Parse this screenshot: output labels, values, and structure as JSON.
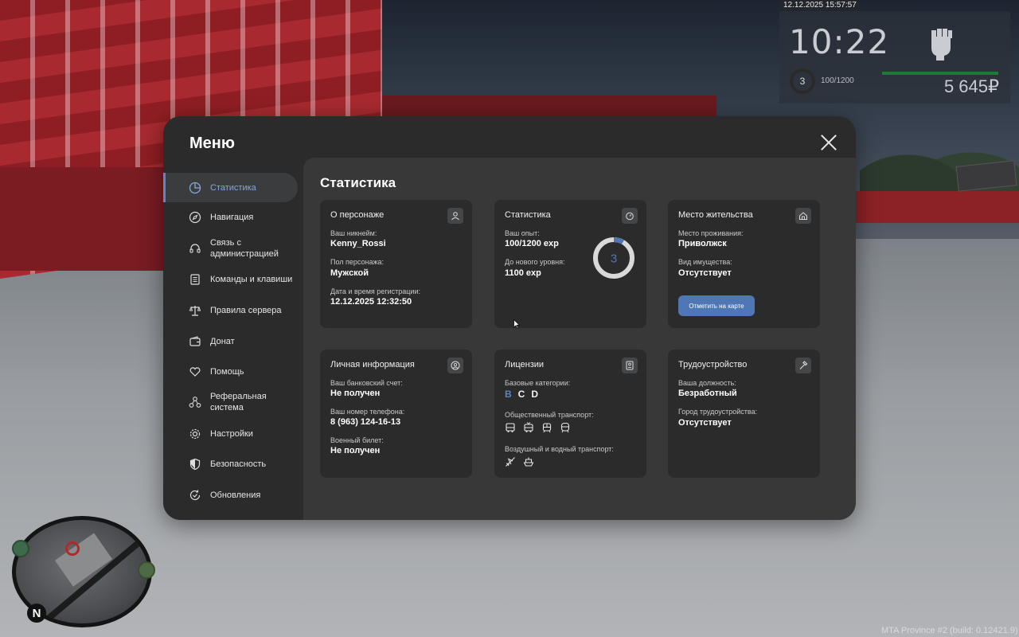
{
  "hud": {
    "timestamp": "12.12.2025 15:57:57",
    "clock": "10:22",
    "level": "3",
    "xp": "100/1200",
    "money": "5 645₽",
    "build": "MTA Province #2 (build: 0.12421.9)",
    "minimap_north": "N"
  },
  "menu": {
    "title": "Меню",
    "sidebar": [
      {
        "label": "Статистика",
        "icon": "pie-chart-icon",
        "active": true
      },
      {
        "label": "Навигация",
        "icon": "compass-icon"
      },
      {
        "label": "Связь с администрацией",
        "icon": "headset-icon"
      },
      {
        "label": "Команды и клавиши",
        "icon": "document-list-icon"
      },
      {
        "label": "Правила сервера",
        "icon": "scales-icon"
      },
      {
        "label": "Донат",
        "icon": "wallet-icon"
      },
      {
        "label": "Помощь",
        "icon": "handshake-heart-icon"
      },
      {
        "label": "Реферальная система",
        "icon": "people-network-icon"
      },
      {
        "label": "Настройки",
        "icon": "gear-icon"
      },
      {
        "label": "Безопасность",
        "icon": "shield-icon"
      },
      {
        "label": "Обновления",
        "icon": "refresh-check-icon"
      }
    ]
  },
  "content": {
    "title": "Статистика",
    "character": {
      "title": "О персонаже",
      "nickname_label": "Ваш никнейм:",
      "nickname": "Kenny_Rossi",
      "gender_label": "Пол персонажа:",
      "gender": "Мужской",
      "reg_label": "Дата и время регистрации:",
      "reg_date": "12.12.2025 12:32:50"
    },
    "stats": {
      "title": "Статистика",
      "xp_label": "Ваш опыт:",
      "xp": "100/1200 exp",
      "next_label": "До нового уровня:",
      "next": "1100 exp",
      "level": "3",
      "progress": 0.0833
    },
    "residence": {
      "title": "Место жительства",
      "place_label": "Место проживания:",
      "place": "Приволжск",
      "property_label": "Вид имущества:",
      "property": "Отсутствует",
      "button": "Отметить на карте"
    },
    "personal": {
      "title": "Личная информация",
      "bank_label": "Ваш банковский счет:",
      "bank": "Не получен",
      "phone_label": "Ваш номер телефона:",
      "phone": "8 (963) 124-16-13",
      "military_label": "Военный билет:",
      "military": "Не получен"
    },
    "licenses": {
      "title": "Лицензии",
      "basic_label": "Базовые категории:",
      "categories": [
        {
          "name": "B",
          "owned": true
        },
        {
          "name": "C",
          "owned": false
        },
        {
          "name": "D",
          "owned": false
        }
      ],
      "public_label": "Общественный транспорт:",
      "public_icons": [
        "bus-icon",
        "trolleybus-icon",
        "tram-icon",
        "metro-icon"
      ],
      "air_label": "Воздушный и водный транспорт:",
      "air_icons": [
        "plane-icon",
        "boat-icon"
      ]
    },
    "employment": {
      "title": "Трудоустройство",
      "position_label": "Ваша должность:",
      "position": "Безработный",
      "city_label": "Город трудоустройства:",
      "city": "Отсутствует"
    }
  },
  "colors": {
    "accent": "#5a86c8",
    "button": "#4f77b5",
    "panel": "#2b2b2b",
    "content": "#383838"
  }
}
